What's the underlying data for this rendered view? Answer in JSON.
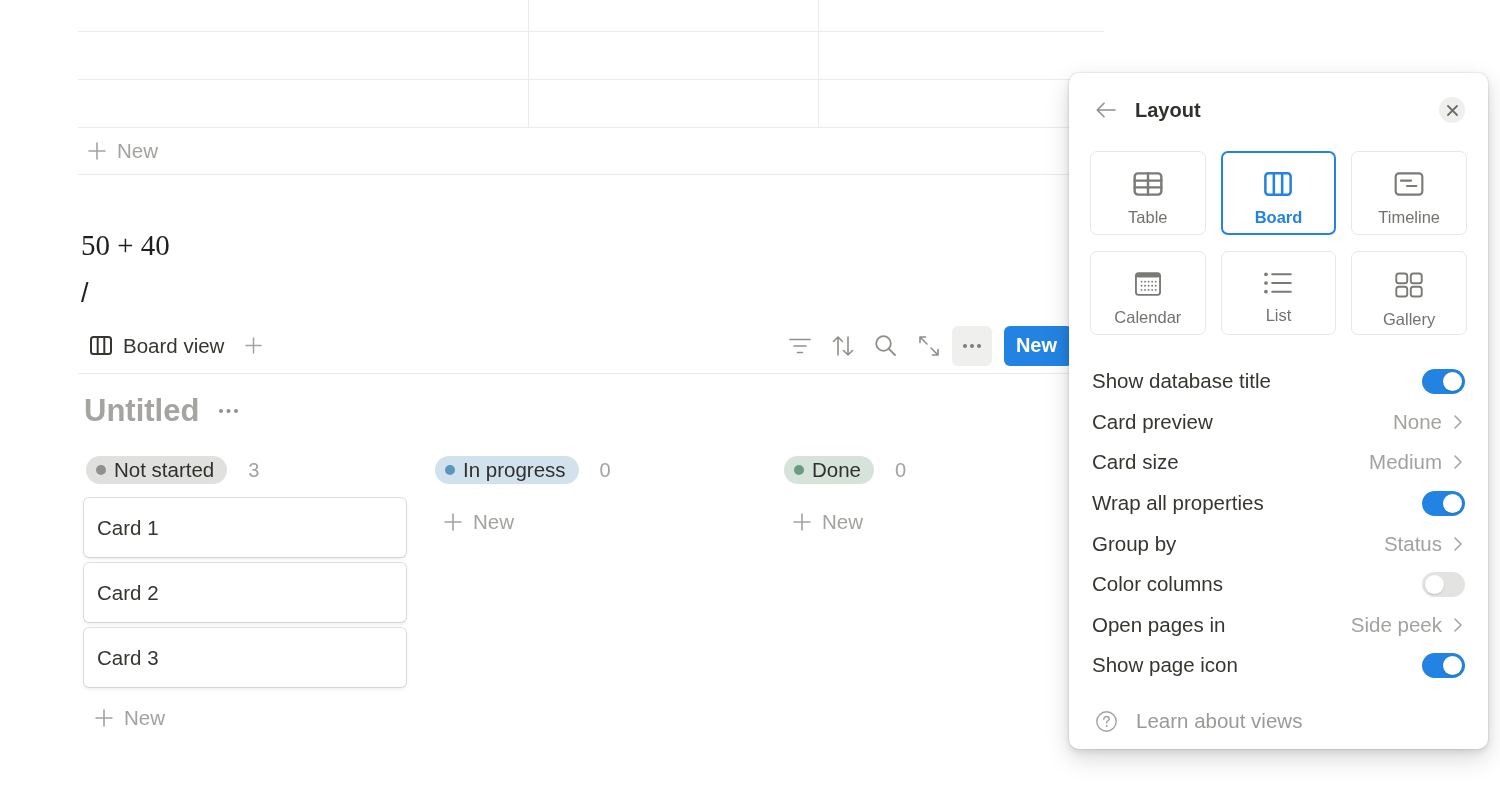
{
  "table": {
    "new_row_label": "New"
  },
  "blocks": [
    {
      "kind": "equation",
      "text": "50 + 40"
    },
    {
      "kind": "text",
      "text": "/"
    }
  ],
  "database": {
    "view_tab": {
      "label": "Board view"
    },
    "toolbar": [
      {
        "kind": "filter",
        "selected": false
      },
      {
        "kind": "sort",
        "selected": false
      },
      {
        "kind": "search",
        "selected": false
      },
      {
        "kind": "expand",
        "selected": false
      },
      {
        "kind": "more",
        "selected": true
      }
    ],
    "new_button": "New",
    "title": "Untitled",
    "groups": [
      {
        "label": "Not started",
        "count": "3",
        "color": "#91918e",
        "cards": [
          {
            "title": "Card 1"
          },
          {
            "title": "Card 2"
          },
          {
            "title": "Card 3"
          }
        ],
        "new_label": "New"
      },
      {
        "label": "In progress",
        "count": "0",
        "color": "#5b97bd",
        "new_label": "New"
      },
      {
        "label": "Done",
        "count": "0",
        "color": "#6c9b7d",
        "new_label": "New"
      }
    ]
  },
  "layout_panel": {
    "title": "Layout",
    "layouts": [
      {
        "kind": "table",
        "label": "Table",
        "selected": false
      },
      {
        "kind": "board",
        "label": "Board",
        "selected": true
      },
      {
        "kind": "timeline",
        "label": "Timeline",
        "selected": false
      },
      {
        "kind": "calendar",
        "label": "Calendar",
        "selected": false
      },
      {
        "kind": "list",
        "label": "List",
        "selected": false
      },
      {
        "kind": "gallery",
        "label": "Gallery",
        "selected": false
      }
    ],
    "settings": [
      {
        "kind": "toggle",
        "label": "Show database title",
        "on": true
      },
      {
        "kind": "select",
        "label": "Card preview",
        "value": "None"
      },
      {
        "kind": "select",
        "label": "Card size",
        "value": "Medium"
      },
      {
        "kind": "toggle",
        "label": "Wrap all properties",
        "on": true
      },
      {
        "kind": "select",
        "label": "Group by",
        "value": "Status"
      },
      {
        "kind": "toggle",
        "label": "Color columns",
        "on": false
      },
      {
        "kind": "select",
        "label": "Open pages in",
        "value": "Side peek"
      },
      {
        "kind": "toggle",
        "label": "Show page icon",
        "on": true
      }
    ],
    "help_link": "Learn about views"
  }
}
